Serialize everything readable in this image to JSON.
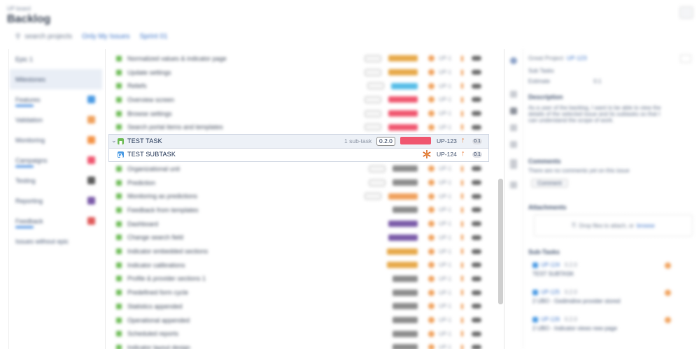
{
  "header": {
    "breadcrumb": "UP board",
    "title": "Backlog",
    "search_label": "search projects",
    "quick_filters": [
      "Only My Issues",
      "Sprint 01"
    ]
  },
  "left_panel": {
    "items": [
      {
        "label": "Epic 1",
        "active": false,
        "color": ""
      },
      {
        "label": "Milestones",
        "active": true,
        "color": ""
      },
      {
        "label": "Features",
        "active": false,
        "color": "#4a9ae3",
        "bar": true
      },
      {
        "label": "Validation",
        "active": false,
        "color": "#f0a15c"
      },
      {
        "label": "Monitoring",
        "active": false,
        "color": "#f49245"
      },
      {
        "label": "Campaigns",
        "active": false,
        "color": "#f0566f",
        "bar": true
      },
      {
        "label": "Testing",
        "active": false,
        "color": "#5b5b5b"
      },
      {
        "label": "Reporting",
        "active": false,
        "color": "#7a5aa8"
      },
      {
        "label": "Feedback",
        "active": false,
        "color": "#e05a5a",
        "bar": true
      },
      {
        "label": "Issues without epic",
        "active": false,
        "color": ""
      }
    ]
  },
  "tasks_top": [
    {
      "name": "Normalized values & indicator page",
      "ver": true,
      "epic": "#e7a94a",
      "epicW": 42
    },
    {
      "name": "Update settings",
      "ver": true,
      "epic": "#e7a94a",
      "epicW": 42
    },
    {
      "name": "Reliefs",
      "ver": true,
      "epic": "#56bde8",
      "epicW": 38
    },
    {
      "name": "Overview screen",
      "ver": true,
      "epic": "#f0566f",
      "epicW": 42
    },
    {
      "name": "Browse settings",
      "ver": true,
      "epic": "#f0566f",
      "epicW": 42
    },
    {
      "name": "Search portal items and templates",
      "ver": true,
      "epic": "#f0566f",
      "epicW": 42
    }
  ],
  "selected_task": {
    "name": "TEST TASK",
    "subtask_count": "1 sub-task",
    "version": "0.2.0",
    "key": "UP-123",
    "priority_icon": "arrow-up",
    "story_points": "0.1",
    "epic_color": "#f0566f"
  },
  "selected_subtask": {
    "name": "TEST SUBTASK",
    "key": "UP-124",
    "priority_icon": "arrow-up",
    "story_points": "0.1"
  },
  "tasks_bottom": [
    {
      "name": "Organizational unit",
      "ver": true,
      "epic": "#8c8c8c",
      "epicW": 36
    },
    {
      "name": "Prediction",
      "ver": true,
      "epic": "#8c8c8c",
      "epicW": 36
    },
    {
      "name": "Monitoring as predictions",
      "ver": true,
      "epic": "#f0a15c",
      "epicW": 42
    },
    {
      "name": "Feedback from templates",
      "ver": false,
      "epic": "#8c8c8c",
      "epicW": 36
    },
    {
      "name": "Dashboard",
      "ver": false,
      "epic": "#7a5aa8",
      "epicW": 42
    },
    {
      "name": "Change search field",
      "ver": false,
      "epic": "#7a5aa8",
      "epicW": 42
    },
    {
      "name": "Indicator embedded sections",
      "ver": false,
      "epic": "#e7a94a",
      "epicW": 44
    },
    {
      "name": "Indicator calibrations",
      "ver": false,
      "epic": "#e7a94a",
      "epicW": 44
    },
    {
      "name": "Profile & provider sections 1",
      "ver": false,
      "epic": "#8c8c8c",
      "epicW": 36
    },
    {
      "name": "Predefined form cycle",
      "ver": false,
      "epic": "#8c8c8c",
      "epicW": 36
    },
    {
      "name": "Statistics appended",
      "ver": false,
      "epic": "#8c8c8c",
      "epicW": 36
    },
    {
      "name": "Operational appended",
      "ver": false,
      "epic": "#8c8c8c",
      "epicW": 36
    },
    {
      "name": "Scheduled reports",
      "ver": false,
      "epic": "#8c8c8c",
      "epicW": 36
    },
    {
      "name": "Indicator layout design",
      "ver": false,
      "epic": "#8c8c8c",
      "epicW": 36
    }
  ],
  "right_panel": {
    "head": "Great Project",
    "head_link": "UP-123",
    "field1": "Sub Tasks",
    "field2_label": "Estimate",
    "field2_value": "0.1",
    "description_title": "Description",
    "description_text": "As a user of the backlog, I want to be able to view the details of the selected issue and its subtasks so that I can understand the scope of work.",
    "comments_title": "Comments",
    "comments_text": "There are no comments yet on this issue",
    "comment_button": "Comment",
    "attachments_title": "Attachments",
    "attachments_drop": "Drop files to attach, or",
    "attachments_browse": "browse",
    "subtasks_title": "Sub-Tasks",
    "subtasks": [
      {
        "key": "UP-124",
        "ver": "0.2.0",
        "name": "TEST SUBTASK"
      },
      {
        "key": "UP-125",
        "ver": "0.2.0",
        "name": "2 UBO - Gedimdine provider stored"
      },
      {
        "key": "UP-126",
        "ver": "0.2.0",
        "name": "2 UBO - Indicator views new page"
      }
    ]
  }
}
